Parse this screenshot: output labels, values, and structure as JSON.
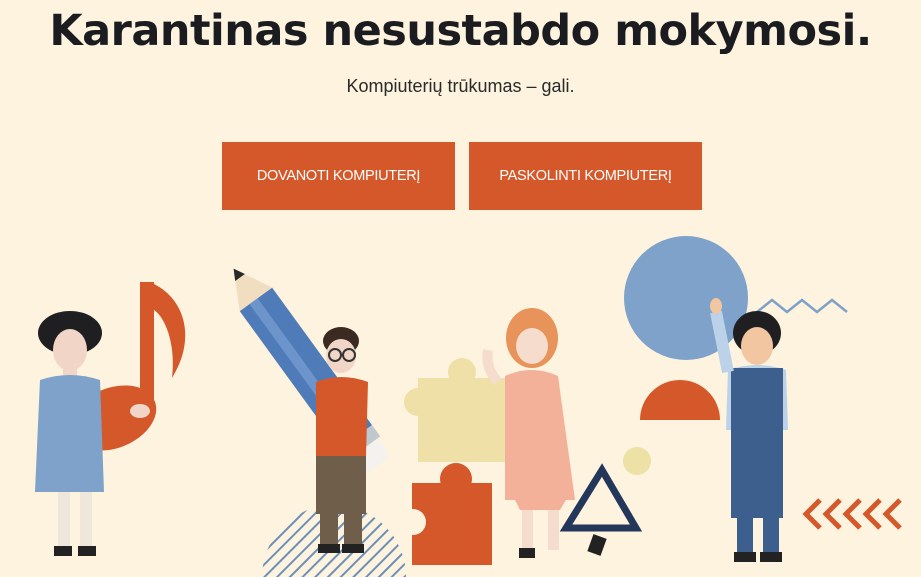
{
  "hero": {
    "headline": "Karantinas nesustabdo mokymosi.",
    "subline": "Kompiuterių trūkumas – gali.",
    "buttons": {
      "donate": "DOVANOTI KOMPIUTERĮ",
      "lend": "PASKOLINTI KOMPIUTERĮ"
    }
  },
  "colors": {
    "background": "#fdf3de",
    "accent": "#d4582a",
    "blue": "#7ea2c9",
    "dark_blue": "#2f4a6e",
    "cream_shape": "#efe0a8"
  }
}
